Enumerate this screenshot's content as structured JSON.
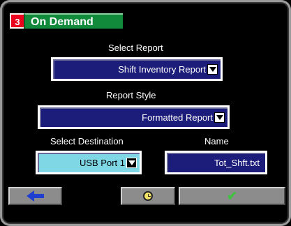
{
  "header": {
    "number": "3",
    "title": "On Demand"
  },
  "select_report": {
    "label": "Select Report",
    "value": "Shift Inventory Report"
  },
  "report_style": {
    "label": "Report Style",
    "value": "Formatted Report"
  },
  "destination": {
    "label": "Select Destination",
    "value": "USB Port 1"
  },
  "name": {
    "label": "Name",
    "value": "Tot_Shft.txt"
  },
  "toolbar": {
    "back_icon": "left-arrow-icon",
    "clock_icon": "clock-icon",
    "confirm_icon": "checkmark-icon"
  },
  "colors": {
    "title_bg": "#128a3c",
    "number_bg": "#e8001c",
    "field_blue": "#1c1c7a",
    "field_cyan": "#7fd7e6",
    "button_gray": "#8c8c8c"
  }
}
